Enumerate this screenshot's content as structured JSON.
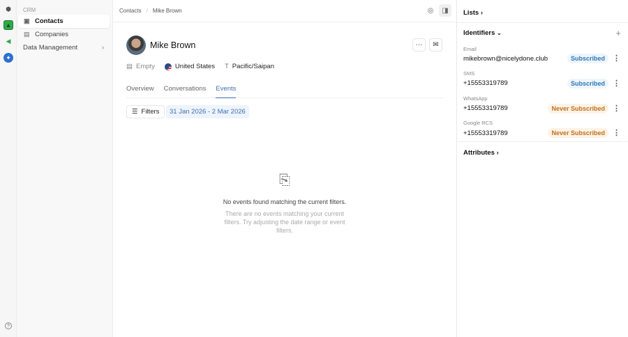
{
  "rail": {
    "icons": [
      "home-icon",
      "contacts-app-icon",
      "campaigns-app-icon",
      "integrations-app-icon",
      "help-icon"
    ]
  },
  "sidebar": {
    "section": "CRM",
    "items": [
      {
        "label": "Contacts",
        "active": true
      },
      {
        "label": "Companies"
      },
      {
        "label": "Data Management"
      }
    ]
  },
  "breadcrumb": [
    "Contacts",
    "/",
    "Mike Brown"
  ],
  "contact": {
    "name": "Mike Brown",
    "company": "Empty",
    "country": "United States",
    "timezone": "Pacific/Saipan"
  },
  "tabs": [
    "Overview",
    "Conversations",
    "Events"
  ],
  "active_tab": "Events",
  "filters": {
    "label": "Filters",
    "date_range": "31 Jan 2026 - 2 Mar 2026"
  },
  "empty_state": {
    "title": "No events found matching the current filters.",
    "description": "There are no events matching your current filters. Try adjusting the date range or event filters."
  },
  "right": {
    "lists": "Lists",
    "identifiers": "Identifiers",
    "attributes": "Attributes",
    "items": [
      {
        "label": "Email",
        "value": "mikebrown@nicelydone.club",
        "status": "Subscribed",
        "kind": "sub"
      },
      {
        "label": "SMS",
        "value": "+15553319789",
        "status": "Subscribed",
        "kind": "sub"
      },
      {
        "label": "WhatsApp",
        "value": "+15553319789",
        "status": "Never Subscribed",
        "kind": "never"
      },
      {
        "label": "Google RCS",
        "value": "+15553319789",
        "status": "Never Subscribed",
        "kind": "never"
      }
    ]
  }
}
